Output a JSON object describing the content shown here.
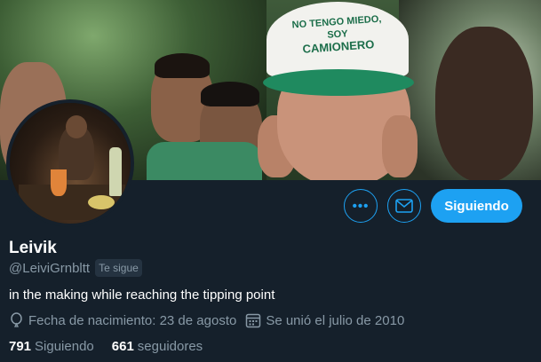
{
  "banner": {
    "cap_text_line1": "NO TENGO MIEDO,",
    "cap_text_line2": "SOY",
    "cap_text_line3": "CAMIONERO"
  },
  "profile": {
    "name": "Leivik",
    "handle": "@LeiviGrnbltt",
    "follows_you": "Te sigue",
    "bio": "in the making while reaching the tipping point",
    "birthday": "Fecha de nacimiento: 23 de agosto",
    "joined": "Se unió el julio de 2010"
  },
  "actions": {
    "more_label": "•••",
    "follow_label": "Siguiendo"
  },
  "stats": {
    "following_count": "791",
    "following_label": "Siguiendo",
    "followers_count": "661",
    "followers_label": "seguidores"
  },
  "colors": {
    "background": "#15202b",
    "accent": "#1da1f2",
    "muted_text": "#8899a6"
  },
  "icons": {
    "more": "more-horizontal-icon",
    "message": "envelope-icon",
    "birthday": "balloon-icon",
    "joined": "calendar-icon"
  }
}
